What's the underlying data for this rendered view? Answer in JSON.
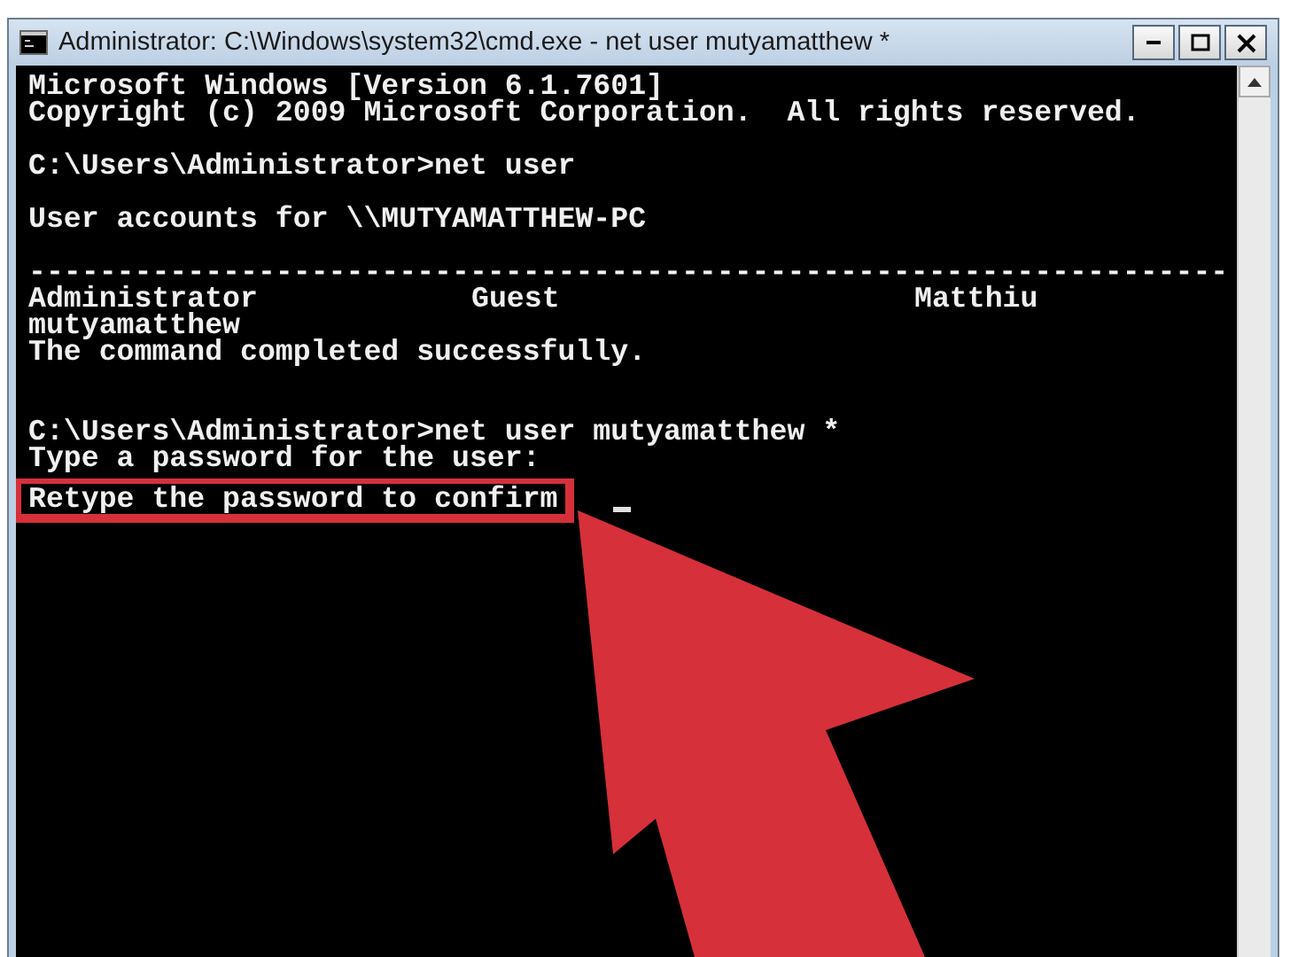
{
  "window": {
    "title": "Administrator: C:\\Windows\\system32\\cmd.exe - net  user mutyamatthew *",
    "buttons": [
      {
        "kind": "minimize"
      },
      {
        "kind": "maximize"
      },
      {
        "kind": "close"
      }
    ]
  },
  "console": {
    "lines": [
      {
        "kind": "text",
        "text": "Microsoft Windows [Version 6.1.7601]"
      },
      {
        "kind": "text",
        "text": "Copyright (c) 2009 Microsoft Corporation.  All rights reserved."
      },
      {
        "kind": "blank"
      },
      {
        "kind": "text",
        "text": "C:\\Users\\Administrator>net user"
      },
      {
        "kind": "blank"
      },
      {
        "kind": "text",
        "text": "User accounts for \\\\MUTYAMATTHEW-PC"
      },
      {
        "kind": "blank"
      },
      {
        "kind": "text",
        "text": "--------------------------------------------------------------------"
      },
      {
        "kind": "columns",
        "cells": [
          "Administrator",
          "Guest",
          "Matthiu"
        ]
      },
      {
        "kind": "text",
        "text": "mutyamatthew"
      },
      {
        "kind": "text",
        "text": "The command completed successfully."
      },
      {
        "kind": "blank"
      },
      {
        "kind": "blank"
      },
      {
        "kind": "text",
        "text": "C:\\Users\\Administrator>net user mutyamatthew *"
      },
      {
        "kind": "text",
        "text": "Type a password for the user:"
      },
      {
        "kind": "text",
        "text": "Retype the password to confirm",
        "highlighted": true,
        "cursor": true
      }
    ]
  }
}
